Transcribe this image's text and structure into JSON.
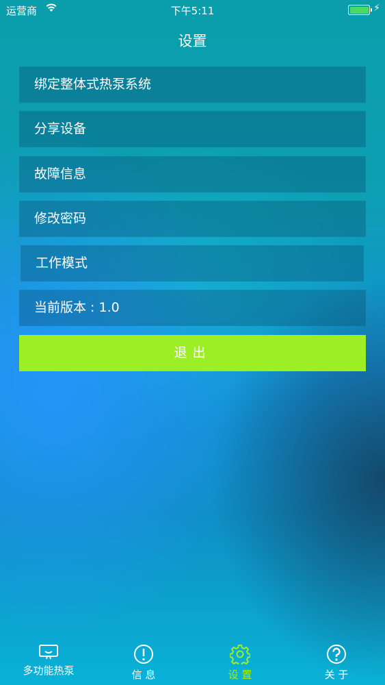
{
  "status_bar": {
    "carrier": "运营商",
    "time": "下午5:11"
  },
  "nav": {
    "title": "设置"
  },
  "menu": [
    {
      "label": "绑定整体式热泵系统"
    },
    {
      "label": "分享设备"
    },
    {
      "label": "故障信息"
    },
    {
      "label": "修改密码"
    },
    {
      "label": "工作模式"
    },
    {
      "label": "当前版本 : 1.0"
    }
  ],
  "logout_label": "退出",
  "tabs": [
    {
      "label": "多功能热泵",
      "icon": "heat-pump-icon"
    },
    {
      "label": "信 息",
      "icon": "alert-circle-icon"
    },
    {
      "label": "设 置",
      "icon": "gear-icon",
      "active": true
    },
    {
      "label": "关 于",
      "icon": "question-circle-icon"
    }
  ],
  "colors": {
    "accent": "#9def25",
    "battery": "#4cd964"
  }
}
